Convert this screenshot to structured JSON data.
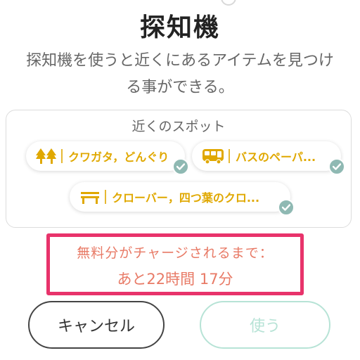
{
  "title": "探知機",
  "description": {
    "line1": "探知機を使うと近くにあるアイテムを見つけ",
    "line2": "る事ができる。"
  },
  "spots": {
    "heading": "近くのスポット",
    "items": [
      {
        "icon": "trees-icon",
        "label": "クワガタ，どんぐり",
        "checked": true
      },
      {
        "icon": "bus-icon",
        "label": "バスのペーパ...",
        "checked": true
      },
      {
        "icon": "bench-icon",
        "label": "クローバー，四つ葉のクロ...",
        "checked": true
      }
    ]
  },
  "notice": {
    "line1": "無料分がチャージされるまで：",
    "line2": "あと22時間 17分"
  },
  "buttons": {
    "cancel_label": "キャンセル",
    "use_label": "使う"
  },
  "colors": {
    "accent_gold": "#e0a800",
    "check_teal": "#8fb9b3",
    "highlight_pink": "#e8336b",
    "notice_text": "#e87a66",
    "use_button_disabled": "#b7e3d6"
  }
}
